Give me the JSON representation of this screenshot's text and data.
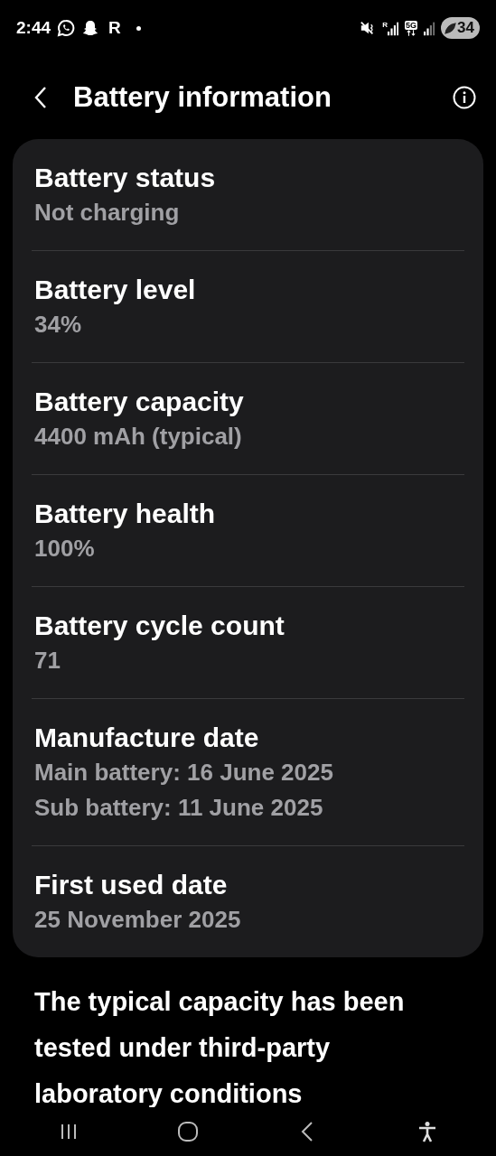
{
  "status_bar": {
    "time": "2:44",
    "notification_letter": "R",
    "roaming": "R",
    "network": "5G",
    "battery": "34"
  },
  "header": {
    "title": "Battery information"
  },
  "items": [
    {
      "title": "Battery status",
      "values": [
        "Not charging"
      ]
    },
    {
      "title": "Battery level",
      "values": [
        "34%"
      ]
    },
    {
      "title": "Battery capacity",
      "values": [
        "4400 mAh (typical)"
      ]
    },
    {
      "title": "Battery health",
      "values": [
        "100%"
      ]
    },
    {
      "title": "Battery cycle count",
      "values": [
        "71"
      ]
    },
    {
      "title": "Manufacture date",
      "values": [
        "Main battery: 16 June 2025",
        "Sub battery: 11 June 2025"
      ]
    },
    {
      "title": "First used date",
      "values": [
        "25 November 2025"
      ]
    }
  ],
  "note": "The typical capacity has been tested under third-party laboratory conditions"
}
